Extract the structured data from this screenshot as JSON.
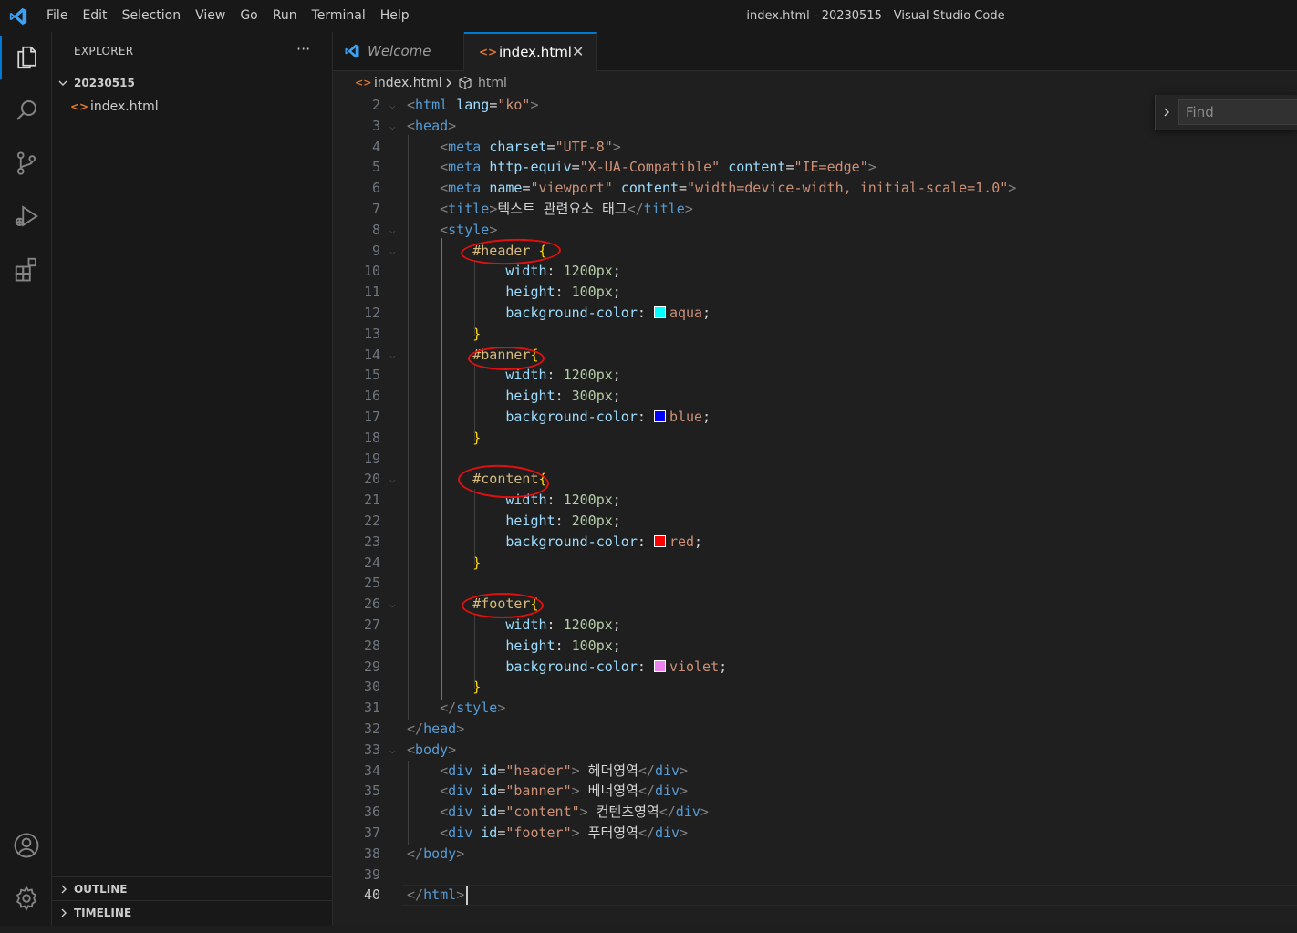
{
  "window": {
    "title": "index.html - 20230515 - Visual Studio Code"
  },
  "menu": [
    "File",
    "Edit",
    "Selection",
    "View",
    "Go",
    "Run",
    "Terminal",
    "Help"
  ],
  "activity_bar": [
    {
      "name": "explorer-icon",
      "active": true
    },
    {
      "name": "search-icon"
    },
    {
      "name": "source-control-icon"
    },
    {
      "name": "run-debug-icon"
    },
    {
      "name": "extensions-icon"
    },
    {
      "name": "account-icon"
    },
    {
      "name": "manage-gear-icon"
    }
  ],
  "sidebar": {
    "title": "EXPLORER",
    "more": "···",
    "folder": "20230515",
    "file": "index.html",
    "sections": [
      "OUTLINE",
      "TIMELINE"
    ]
  },
  "tabs": [
    {
      "label": "Welcome",
      "active": false
    },
    {
      "label": "index.html",
      "active": true,
      "close": "✕"
    }
  ],
  "breadcrumb": [
    "index.html",
    "html"
  ],
  "find": {
    "placeholder": "Find",
    "value": ""
  },
  "colors": {
    "accent": "#0078d4",
    "annotation": "#e01010",
    "aqua": "#00ffff",
    "blue": "#0000ff",
    "red": "#ff0000",
    "violet": "#ee82ee"
  },
  "editor": {
    "language": "html",
    "current_line": 40,
    "lines": [
      {
        "n": "2",
        "fold": true,
        "t": [
          [
            "tg",
            "<"
          ],
          [
            "tn",
            "html"
          ],
          [
            "tx",
            " "
          ],
          [
            "at",
            "lang"
          ],
          [
            "tx",
            "="
          ],
          [
            "st",
            "\"ko\""
          ],
          [
            "tg",
            ">"
          ]
        ]
      },
      {
        "n": "3",
        "fold": true,
        "t": [
          [
            "tg",
            "<"
          ],
          [
            "tn",
            "head"
          ],
          [
            "tg",
            ">"
          ]
        ]
      },
      {
        "n": "4",
        "t": [
          [
            "tx",
            "    "
          ],
          [
            "tg",
            "<"
          ],
          [
            "tn",
            "meta"
          ],
          [
            "tx",
            " "
          ],
          [
            "at",
            "charset"
          ],
          [
            "tx",
            "="
          ],
          [
            "st",
            "\"UTF-8\""
          ],
          [
            "tg",
            ">"
          ]
        ]
      },
      {
        "n": "5",
        "t": [
          [
            "tx",
            "    "
          ],
          [
            "tg",
            "<"
          ],
          [
            "tn",
            "meta"
          ],
          [
            "tx",
            " "
          ],
          [
            "at",
            "http-equiv"
          ],
          [
            "tx",
            "="
          ],
          [
            "st",
            "\"X-UA-Compatible\""
          ],
          [
            "tx",
            " "
          ],
          [
            "at",
            "content"
          ],
          [
            "tx",
            "="
          ],
          [
            "st",
            "\"IE=edge\""
          ],
          [
            "tg",
            ">"
          ]
        ]
      },
      {
        "n": "6",
        "t": [
          [
            "tx",
            "    "
          ],
          [
            "tg",
            "<"
          ],
          [
            "tn",
            "meta"
          ],
          [
            "tx",
            " "
          ],
          [
            "at",
            "name"
          ],
          [
            "tx",
            "="
          ],
          [
            "st",
            "\"viewport\""
          ],
          [
            "tx",
            " "
          ],
          [
            "at",
            "content"
          ],
          [
            "tx",
            "="
          ],
          [
            "st",
            "\"width=device-width, initial-scale=1.0\""
          ],
          [
            "tg",
            ">"
          ]
        ]
      },
      {
        "n": "7",
        "t": [
          [
            "tx",
            "    "
          ],
          [
            "tg",
            "<"
          ],
          [
            "tn",
            "title"
          ],
          [
            "tg",
            ">"
          ],
          [
            "tx",
            "텍스트 관련요소 태그"
          ],
          [
            "tg",
            "</"
          ],
          [
            "tn",
            "title"
          ],
          [
            "tg",
            ">"
          ]
        ]
      },
      {
        "n": "8",
        "fold": true,
        "t": [
          [
            "tx",
            "    "
          ],
          [
            "tg",
            "<"
          ],
          [
            "tn",
            "style"
          ],
          [
            "tg",
            ">"
          ]
        ]
      },
      {
        "n": "9",
        "fold": true,
        "t": [
          [
            "tx",
            "        "
          ],
          [
            "sel",
            "#header"
          ],
          [
            "tx",
            " "
          ],
          [
            "br",
            "{"
          ]
        ]
      },
      {
        "n": "10",
        "t": [
          [
            "tx",
            "            "
          ],
          [
            "pr",
            "width"
          ],
          [
            "tx",
            ": "
          ],
          [
            "nm",
            "1200px"
          ],
          [
            "tx",
            ";"
          ]
        ]
      },
      {
        "n": "11",
        "t": [
          [
            "tx",
            "            "
          ],
          [
            "pr",
            "height"
          ],
          [
            "tx",
            ": "
          ],
          [
            "nm",
            "100px"
          ],
          [
            "tx",
            ";"
          ]
        ]
      },
      {
        "n": "12",
        "t": [
          [
            "tx",
            "            "
          ],
          [
            "pr",
            "background-color"
          ],
          [
            "tx",
            ": "
          ],
          [
            "sw",
            "aqua"
          ],
          [
            "st",
            "aqua"
          ],
          [
            "tx",
            ";"
          ]
        ]
      },
      {
        "n": "13",
        "t": [
          [
            "tx",
            "        "
          ],
          [
            "br",
            "}"
          ]
        ]
      },
      {
        "n": "14",
        "fold": true,
        "t": [
          [
            "tx",
            "        "
          ],
          [
            "sel",
            "#banner"
          ],
          [
            "br",
            "{"
          ]
        ]
      },
      {
        "n": "15",
        "t": [
          [
            "tx",
            "            "
          ],
          [
            "pr",
            "width"
          ],
          [
            "tx",
            ": "
          ],
          [
            "nm",
            "1200px"
          ],
          [
            "tx",
            ";"
          ]
        ]
      },
      {
        "n": "16",
        "t": [
          [
            "tx",
            "            "
          ],
          [
            "pr",
            "height"
          ],
          [
            "tx",
            ": "
          ],
          [
            "nm",
            "300px"
          ],
          [
            "tx",
            ";"
          ]
        ]
      },
      {
        "n": "17",
        "t": [
          [
            "tx",
            "            "
          ],
          [
            "pr",
            "background-color"
          ],
          [
            "tx",
            ": "
          ],
          [
            "sw",
            "blue"
          ],
          [
            "st",
            "blue"
          ],
          [
            "tx",
            ";"
          ]
        ]
      },
      {
        "n": "18",
        "t": [
          [
            "tx",
            "        "
          ],
          [
            "br",
            "}"
          ]
        ]
      },
      {
        "n": "19",
        "t": []
      },
      {
        "n": "20",
        "fold": true,
        "t": [
          [
            "tx",
            "        "
          ],
          [
            "sel",
            "#content"
          ],
          [
            "br",
            "{"
          ]
        ]
      },
      {
        "n": "21",
        "t": [
          [
            "tx",
            "            "
          ],
          [
            "pr",
            "width"
          ],
          [
            "tx",
            ": "
          ],
          [
            "nm",
            "1200px"
          ],
          [
            "tx",
            ";"
          ]
        ]
      },
      {
        "n": "22",
        "t": [
          [
            "tx",
            "            "
          ],
          [
            "pr",
            "height"
          ],
          [
            "tx",
            ": "
          ],
          [
            "nm",
            "200px"
          ],
          [
            "tx",
            ";"
          ]
        ]
      },
      {
        "n": "23",
        "t": [
          [
            "tx",
            "            "
          ],
          [
            "pr",
            "background-color"
          ],
          [
            "tx",
            ": "
          ],
          [
            "sw",
            "red"
          ],
          [
            "st",
            "red"
          ],
          [
            "tx",
            ";"
          ]
        ]
      },
      {
        "n": "24",
        "t": [
          [
            "tx",
            "        "
          ],
          [
            "br",
            "}"
          ]
        ]
      },
      {
        "n": "25",
        "t": []
      },
      {
        "n": "26",
        "fold": true,
        "t": [
          [
            "tx",
            "        "
          ],
          [
            "sel",
            "#footer"
          ],
          [
            "br",
            "{"
          ]
        ]
      },
      {
        "n": "27",
        "t": [
          [
            "tx",
            "            "
          ],
          [
            "pr",
            "width"
          ],
          [
            "tx",
            ": "
          ],
          [
            "nm",
            "1200px"
          ],
          [
            "tx",
            ";"
          ]
        ]
      },
      {
        "n": "28",
        "t": [
          [
            "tx",
            "            "
          ],
          [
            "pr",
            "height"
          ],
          [
            "tx",
            ": "
          ],
          [
            "nm",
            "100px"
          ],
          [
            "tx",
            ";"
          ]
        ]
      },
      {
        "n": "29",
        "t": [
          [
            "tx",
            "            "
          ],
          [
            "pr",
            "background-color"
          ],
          [
            "tx",
            ": "
          ],
          [
            "sw",
            "violet"
          ],
          [
            "st",
            "violet"
          ],
          [
            "tx",
            ";"
          ]
        ]
      },
      {
        "n": "30",
        "t": [
          [
            "tx",
            "        "
          ],
          [
            "br",
            "}"
          ]
        ]
      },
      {
        "n": "31",
        "t": [
          [
            "tx",
            "    "
          ],
          [
            "tg",
            "</"
          ],
          [
            "tn",
            "style"
          ],
          [
            "tg",
            ">"
          ]
        ]
      },
      {
        "n": "32",
        "t": [
          [
            "tg",
            "</"
          ],
          [
            "tn",
            "head"
          ],
          [
            "tg",
            ">"
          ]
        ]
      },
      {
        "n": "33",
        "fold": true,
        "t": [
          [
            "tg",
            "<"
          ],
          [
            "tn",
            "body"
          ],
          [
            "tg",
            ">"
          ]
        ]
      },
      {
        "n": "34",
        "t": [
          [
            "tx",
            "    "
          ],
          [
            "tg",
            "<"
          ],
          [
            "tn",
            "div"
          ],
          [
            "tx",
            " "
          ],
          [
            "at",
            "id"
          ],
          [
            "tx",
            "="
          ],
          [
            "st",
            "\"header\""
          ],
          [
            "tg",
            ">"
          ],
          [
            "tx",
            " 헤더영역"
          ],
          [
            "tg",
            "</"
          ],
          [
            "tn",
            "div"
          ],
          [
            "tg",
            ">"
          ]
        ]
      },
      {
        "n": "35",
        "t": [
          [
            "tx",
            "    "
          ],
          [
            "tg",
            "<"
          ],
          [
            "tn",
            "div"
          ],
          [
            "tx",
            " "
          ],
          [
            "at",
            "id"
          ],
          [
            "tx",
            "="
          ],
          [
            "st",
            "\"banner\""
          ],
          [
            "tg",
            ">"
          ],
          [
            "tx",
            " 베너영역"
          ],
          [
            "tg",
            "</"
          ],
          [
            "tn",
            "div"
          ],
          [
            "tg",
            ">"
          ]
        ]
      },
      {
        "n": "36",
        "t": [
          [
            "tx",
            "    "
          ],
          [
            "tg",
            "<"
          ],
          [
            "tn",
            "div"
          ],
          [
            "tx",
            " "
          ],
          [
            "at",
            "id"
          ],
          [
            "tx",
            "="
          ],
          [
            "st",
            "\"content\""
          ],
          [
            "tg",
            ">"
          ],
          [
            "tx",
            " 컨텐츠영역"
          ],
          [
            "tg",
            "</"
          ],
          [
            "tn",
            "div"
          ],
          [
            "tg",
            ">"
          ]
        ]
      },
      {
        "n": "37",
        "t": [
          [
            "tx",
            "    "
          ],
          [
            "tg",
            "<"
          ],
          [
            "tn",
            "div"
          ],
          [
            "tx",
            " "
          ],
          [
            "at",
            "id"
          ],
          [
            "tx",
            "="
          ],
          [
            "st",
            "\"footer\""
          ],
          [
            "tg",
            ">"
          ],
          [
            "tx",
            " 푸터영역"
          ],
          [
            "tg",
            "</"
          ],
          [
            "tn",
            "div"
          ],
          [
            "tg",
            ">"
          ]
        ]
      },
      {
        "n": "38",
        "t": [
          [
            "tg",
            "</"
          ],
          [
            "tn",
            "body"
          ],
          [
            "tg",
            ">"
          ]
        ]
      },
      {
        "n": "39",
        "t": []
      },
      {
        "n": "40",
        "t": [
          [
            "tg",
            "</"
          ],
          [
            "tn",
            "html"
          ],
          [
            "tg",
            ">"
          ]
        ]
      }
    ]
  }
}
